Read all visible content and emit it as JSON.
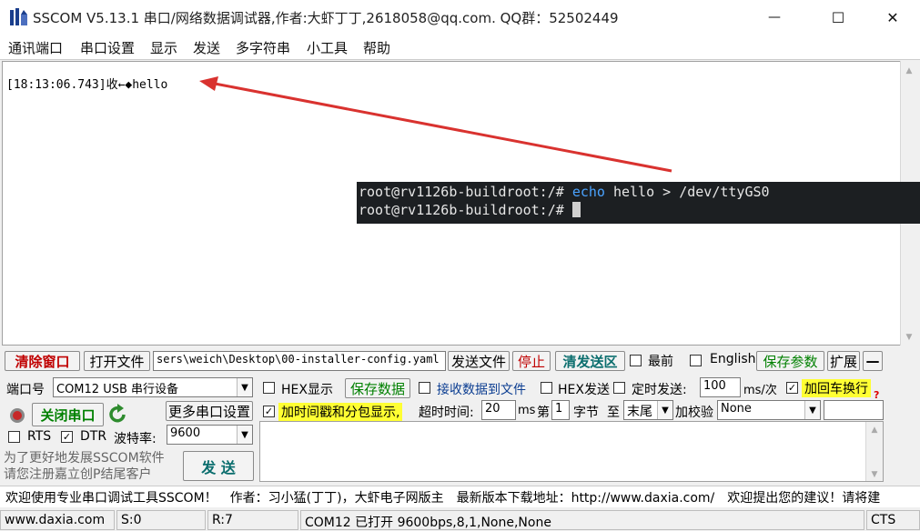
{
  "window": {
    "title": "SSCOM V5.13.1 串口/网络数据调试器,作者:大虾丁丁,2618058@qq.com. QQ群：52502449",
    "minimize_glyph": "—",
    "maximize_glyph": "☐",
    "close_glyph": "✕"
  },
  "menu": [
    "通讯端口",
    "串口设置",
    "显示",
    "发送",
    "多字符串",
    "小工具",
    "帮助"
  ],
  "receive": {
    "line": "[18:13:06.743]收←◆hello",
    "up_arrow": "▲",
    "down_arrow": "▼"
  },
  "terminal": {
    "prompt1": "root@rv1126b-buildroot:/# ",
    "cmd1": "echo",
    "rest1": " hello > /dev/ttyGS0",
    "prompt2": "root@rv1126b-buildroot:/# "
  },
  "toolbar": {
    "clear_window": "清除窗口",
    "open_file": "打开文件",
    "file_path": "sers\\weich\\Desktop\\00-installer-config.yaml",
    "send_file": "发送文件",
    "stop": "停止",
    "clear_send": "清发送区",
    "front": "最前",
    "english": "English",
    "save_params": "保存参数",
    "expand": "扩展",
    "collapse": "—"
  },
  "port": {
    "port_label": "端口号",
    "port_value": "COM12 USB 串行设备",
    "close_port": "关闭串口",
    "more_settings": "更多串口设置",
    "rts": "RTS",
    "dtr": "DTR",
    "baud_label": "波特率:",
    "baud_value": "9600",
    "promo1": "为了更好地发展SSCOM软件",
    "promo2": "请您注册嘉立创P结尾客户",
    "send": "发  送"
  },
  "options": {
    "hex_display": "HEX显示",
    "save_data": "保存数据",
    "recv_to_file": "接收数据到文件",
    "hex_send": "HEX发送",
    "timed_send": "定时发送:",
    "interval": "100",
    "interval_unit": "ms/次",
    "crlf": "加回车换行",
    "timestamp": "加时间戳和分包显示,",
    "timeout_label": "超时时间:",
    "timeout": "20",
    "timeout_unit": "ms",
    "byte_prefix": "第",
    "byte_num": "1",
    "byte_label": "字节",
    "to": "至",
    "end": "末尾",
    "checksum_label": "加校验",
    "checksum_value": "None",
    "help_mark": "?"
  },
  "status_line": "欢迎使用专业串口调试工具SSCOM！　作者：习小猛(丁丁)，大虾电子网版主　最新版本下载地址：http://www.daxia.com/　欢迎提出您的建议！请将建",
  "statusbar": {
    "site": "www.daxia.com",
    "sent": "S:0",
    "recv": "R:7",
    "port_state": "COM12 已打开  9600bps,8,1,None,None",
    "cts": "CTS"
  },
  "colors": {
    "arrow": "#d9322f",
    "terminal_bg": "#1c1f22",
    "highlight": "#ffff33"
  }
}
